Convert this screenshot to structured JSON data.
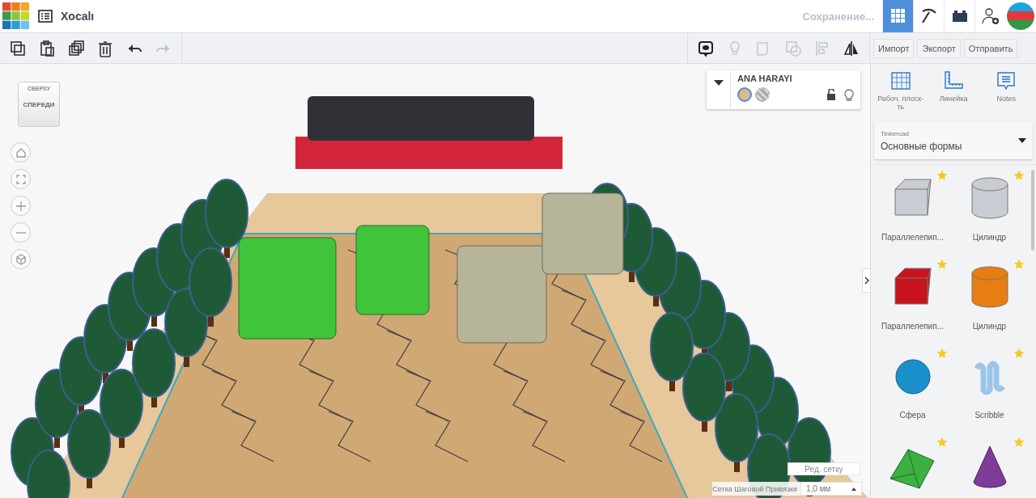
{
  "app": {
    "title": "Xocalı",
    "save_status": "Сохранение..."
  },
  "top_icons": [
    {
      "kind": "grid",
      "selected": true
    },
    {
      "kind": "pickaxe",
      "selected": false
    },
    {
      "kind": "brick",
      "selected": false
    },
    {
      "kind": "add-user",
      "selected": false
    }
  ],
  "edit_tools": [
    {
      "kind": "copy",
      "disabled": false
    },
    {
      "kind": "paste",
      "disabled": false
    },
    {
      "kind": "duplicate",
      "disabled": false
    },
    {
      "kind": "delete",
      "disabled": false
    },
    {
      "kind": "undo",
      "disabled": false
    },
    {
      "kind": "redo",
      "disabled": true
    }
  ],
  "view_tools": [
    {
      "kind": "note",
      "disabled": false
    },
    {
      "kind": "light",
      "disabled": true
    },
    {
      "kind": "group",
      "disabled": true
    },
    {
      "kind": "hole",
      "disabled": true
    },
    {
      "kind": "align",
      "disabled": true
    },
    {
      "kind": "mirror",
      "disabled": false
    }
  ],
  "action_buttons": [
    "Импорт",
    "Экспорт",
    "Отправить"
  ],
  "view_cube": {
    "top": "СВЕРХУ",
    "front": "СПЕРЕДИ"
  },
  "nav_buttons": [
    {
      "kind": "home"
    },
    {
      "kind": "fit"
    },
    {
      "kind": "zoom-in"
    },
    {
      "kind": "zoom-out"
    },
    {
      "kind": "perspective"
    }
  ],
  "shape_inspector": {
    "title": "ANA HARAYI",
    "locked": false,
    "swatches": [
      {
        "kind": "solid",
        "color": "#e0b887",
        "selected": true
      },
      {
        "kind": "hole",
        "selected": false
      }
    ]
  },
  "panel_tabs": [
    {
      "kind": "workplane",
      "label": "Рабоч. плоск-ть"
    },
    {
      "kind": "ruler",
      "label": "Линейка"
    },
    {
      "kind": "notes",
      "label": "Notes"
    }
  ],
  "library": {
    "source": "Tinkercad",
    "category": "Основные формы"
  },
  "shapes": [
    {
      "kind": "box",
      "color": "#c9ccd2",
      "name": "Параллелепип..."
    },
    {
      "kind": "cylinder",
      "color": "#c9ccd2",
      "name": "Цилиндр"
    },
    {
      "kind": "box",
      "color": "#c8141e",
      "name": "Параллелепип..."
    },
    {
      "kind": "cylinder",
      "color": "#e87d12",
      "name": "Цилиндр"
    },
    {
      "kind": "sphere",
      "color": "#1a8fc9",
      "name": "Сфера"
    },
    {
      "kind": "scribble",
      "color": "#9cc6e8",
      "name": "Scribble"
    },
    {
      "kind": "roof",
      "color": "#3cb043"
    },
    {
      "kind": "cone",
      "color": "#7d3c98"
    }
  ],
  "grid": {
    "edit_button": "Ред. сетку",
    "snap_label": "Сетка Шаговой Привязки",
    "snap_value": "1,0 мм"
  }
}
